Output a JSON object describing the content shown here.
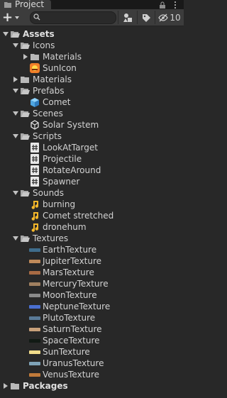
{
  "tab": {
    "title": "Project",
    "hidden_count": "10"
  },
  "toolbar": {
    "plus_label": "+",
    "search_placeholder": ""
  },
  "tree": {
    "assets": "Assets",
    "icons": "Icons",
    "icons_materials": "Materials",
    "sunicon": "SunIcon",
    "materials": "Materials",
    "prefabs": "Prefabs",
    "comet": "Comet",
    "scenes": "Scenes",
    "solar_system": "Solar System",
    "scripts": "Scripts",
    "script_items": [
      "LookAtTarget",
      "Projectile",
      "RotateAround",
      "Spawner"
    ],
    "sounds": "Sounds",
    "sound_items": [
      "burning",
      "Comet stretched",
      "dronehum"
    ],
    "textures": "Textures",
    "texture_items": [
      {
        "name": "EarthTexture",
        "color": "#3f6d8c"
      },
      {
        "name": "JupiterTexture",
        "color": "#c08a5a"
      },
      {
        "name": "MarsTexture",
        "color": "#a86b44"
      },
      {
        "name": "MercuryTexture",
        "color": "#a08060"
      },
      {
        "name": "MoonTexture",
        "color": "#8a8a8a"
      },
      {
        "name": "NeptuneTexture",
        "color": "#4a6fd0"
      },
      {
        "name": "PlutoTexture",
        "color": "#5a7a98"
      },
      {
        "name": "SaturnTexture",
        "color": "#c8a07a"
      },
      {
        "name": "SpaceTexture",
        "color": "#111a14"
      },
      {
        "name": "SunTexture",
        "color": "#f1dc8a"
      },
      {
        "name": "UranusTexture",
        "color": "#7fa3b8"
      },
      {
        "name": "VenusTexture",
        "color": "#c07a3a"
      }
    ],
    "packages": "Packages"
  }
}
